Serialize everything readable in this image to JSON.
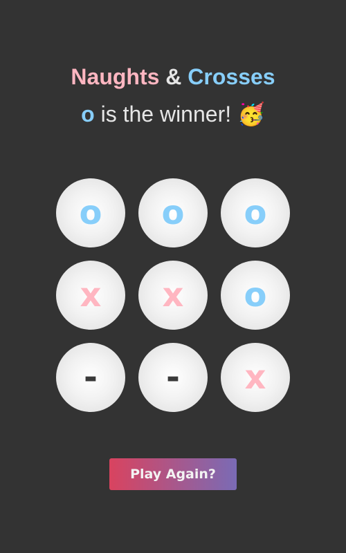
{
  "title": {
    "part1": "Naughts",
    "amp": "&",
    "part2": "Crosses"
  },
  "status": {
    "winner": "o",
    "message": "is the winner!",
    "emoji": "🥳"
  },
  "board": {
    "cells": [
      "o",
      "o",
      "o",
      "x",
      "x",
      "o",
      "-",
      "-",
      "x"
    ]
  },
  "play_again_label": "Play Again?",
  "colors": {
    "background": "#333333",
    "naught": "#87cefa",
    "cross": "#ffb6c1",
    "button_gradient_start": "#d9435f",
    "button_gradient_end": "#7a6bb5"
  }
}
